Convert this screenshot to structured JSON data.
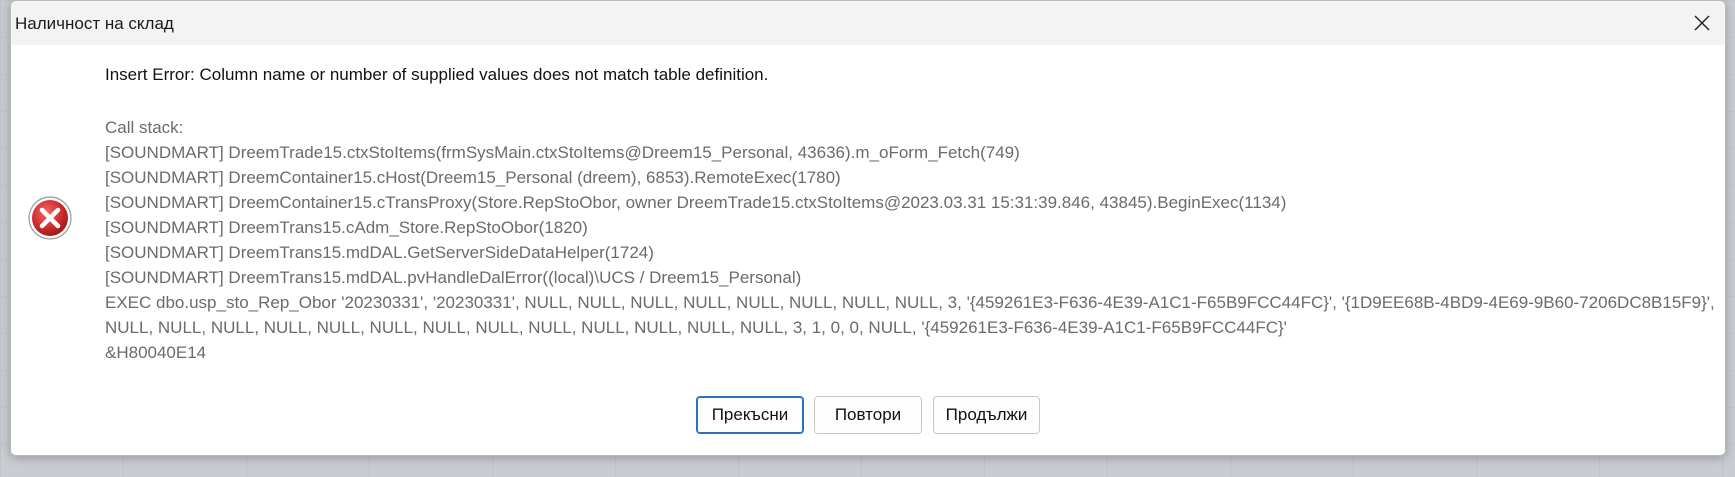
{
  "window": {
    "title": "Наличност на склад",
    "close_icon": "close-icon"
  },
  "dialog": {
    "icon": "error-icon",
    "icon_color": "#c62828",
    "message": "Insert Error: Column name or number of supplied values does not match table definition.",
    "details": [
      "Call stack:",
      "[SOUNDMART] DreemTrade15.ctxStoItems(frmSysMain.ctxStoItems@Dreem15_Personal, 43636).m_oForm_Fetch(749)",
      "[SOUNDMART] DreemContainer15.cHost(Dreem15_Personal (dreem), 6853).RemoteExec(1780)",
      "[SOUNDMART] DreemContainer15.cTransProxy(Store.RepStoObor, owner DreemTrade15.ctxStoItems@2023.03.31 15:31:39.846, 43845).BeginExec(1134)",
      "[SOUNDMART] DreemTrans15.cAdm_Store.RepStoObor(1820)",
      "[SOUNDMART] DreemTrans15.mdDAL.GetServerSideDataHelper(1724)",
      "[SOUNDMART] DreemTrans15.mdDAL.pvHandleDalError((local)\\UCS / Dreem15_Personal)",
      "EXEC dbo.usp_sto_Rep_Obor '20230331', '20230331', NULL, NULL, NULL, NULL, NULL, NULL, NULL, NULL, 3, '{459261E3-F636-4E39-A1C1-F65B9FCC44FC}', '{1D9EE68B-4BD9-4E69-9B60-7206DC8B15F9}',",
      "NULL, NULL, NULL, NULL, NULL, NULL, NULL, NULL, NULL, NULL, NULL, NULL, NULL, 3, 1, 0, 0, NULL, '{459261E3-F636-4E39-A1C1-F65B9FCC44FC}'",
      "&H80040E14"
    ]
  },
  "buttons": {
    "abort": "Прекъсни",
    "retry": "Повтори",
    "continue": "Продължи"
  }
}
